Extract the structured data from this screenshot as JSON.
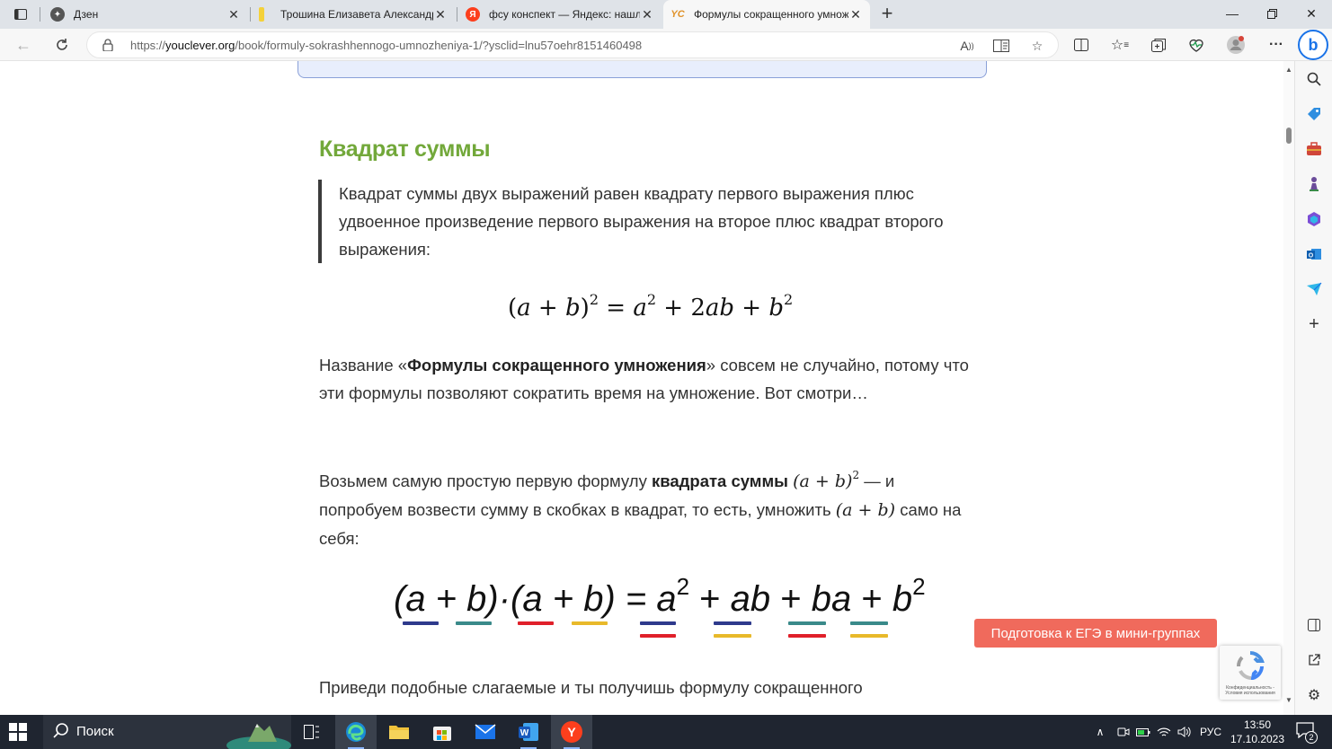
{
  "browser": {
    "tabs": [
      {
        "title": "Дзен",
        "icon": "zen-icon"
      },
      {
        "title": "Трошина Елизавета Александро",
        "icon": "document-icon"
      },
      {
        "title": "фсу конспект — Яндекс: нашло",
        "icon": "yandex-icon"
      },
      {
        "title": "Формулы сокращенного умнож",
        "icon": "youclever-icon",
        "favicon_text": "YC",
        "active": true
      }
    ],
    "url_prefix": "https://",
    "url_host": "youclever.org",
    "url_path": "/book/formuly-sokrashhennogo-umnozheniya-1/?ysclid=lnu57oehr8151460498",
    "bing_label": "b"
  },
  "article": {
    "heading": "Квадрат суммы",
    "quote": "Квадрат суммы двух выражений равен квадрату первого выражения плюс удвоенное произведение первого выражения на второе плюс квадрат второго выражения:",
    "formula": {
      "lhs_open": "(",
      "lhs_a": "a",
      "lhs_plus": " + ",
      "lhs_b": "b",
      "lhs_close": ")",
      "lhs_exp": "2",
      "eq": " = ",
      "t1": "a",
      "t1_exp": "2",
      "plus1": " + 2",
      "t2": "ab",
      "plus2": " + ",
      "t3": "b",
      "t3_exp": "2"
    },
    "para1_pre": "Название «",
    "para1_bold": "Формулы сокращенного умножения",
    "para1_post": "» совсем не случайно, потому что эти формулы позволяют сократить время на умножение. Вот смотри…",
    "para2_pre": "Возьмем самую простую первую формулу ",
    "para2_bold": "квадрата суммы",
    "para2_math1_base": "(a + b)",
    "para2_math1_exp": "2",
    "para2_mid": " — и попробуем возвести сумму в скобках в квадрат, то есть, умножить ",
    "para2_math2": "(a + b)",
    "para2_post": " само на себя:",
    "expansion": {
      "left": "(a + b)·(a + b) = ",
      "t1": "a",
      "t1_exp": "2",
      "p1": " + ",
      "t2": "ab",
      "p2": " + ",
      "t3": "ba",
      "p3": " + ",
      "t4": "b",
      "t4_exp": "2",
      "colors": {
        "navy": "#2e3a8c",
        "teal": "#3a8a8a",
        "red": "#e0202a",
        "gold": "#e8b92a"
      }
    },
    "para3": "Приведи подобные слагаемые и ты получишь формулу сокращенного"
  },
  "cta_button": "Подготовка к ЕГЭ в мини-группах",
  "recaptcha_text": "Конфиденциальность - Условия использования",
  "taskbar": {
    "search_label": "Поиск",
    "language": "РУС",
    "time": "13:50",
    "date": "17.10.2023",
    "notifications": "2"
  }
}
